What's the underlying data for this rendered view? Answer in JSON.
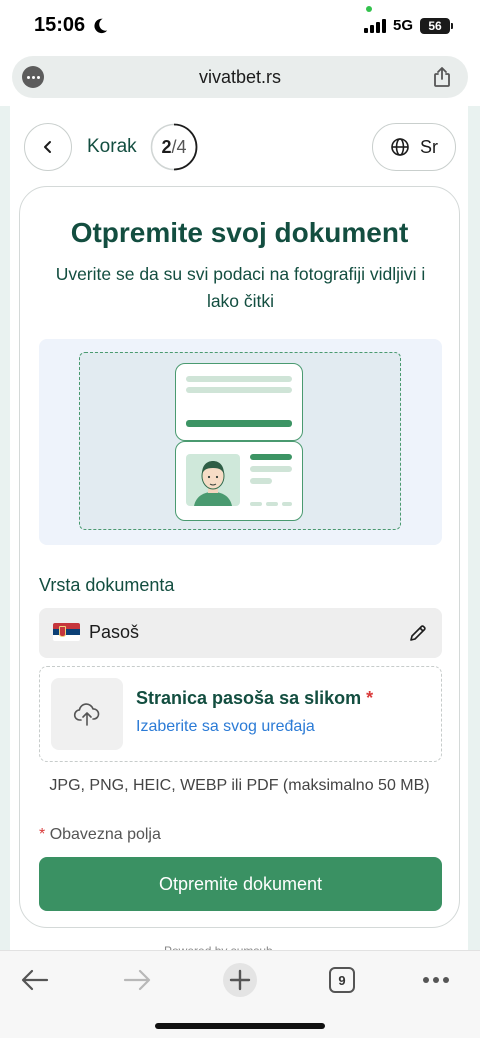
{
  "status_bar": {
    "time": "15:06",
    "network": "5G",
    "battery": "56"
  },
  "browser": {
    "url": "vivatbet.rs"
  },
  "nav": {
    "step_label": "Korak",
    "step_current": "2",
    "step_total": "/4",
    "step_progress": 0.5,
    "language": "Sr"
  },
  "card": {
    "title": "Otpremite svoj dokument",
    "subtitle": "Uverite se da su svi podaci na fotografiji vidljivi i lako čitki",
    "doc_type_label": "Vrsta dokumenta",
    "doc_type_value": "Pasoš",
    "upload_title": "Stranica pasoša sa slikom",
    "upload_required_mark": "*",
    "upload_link": "Izaberite sa svog uređaja",
    "formats": "JPG, PNG, HEIC, WEBP ili PDF (maksimalno 50 MB)",
    "required_note": "Obavezna polja",
    "required_mark": "*",
    "submit_label": "Otpremite dokument"
  },
  "footer": {
    "powered_by": "Powered by sumsub"
  },
  "toolbar": {
    "tab_count": "9"
  },
  "colors": {
    "brand_dark": "#134e40",
    "brand_button": "#3a9163",
    "link": "#2b7bd6",
    "required": "#d93a3a"
  },
  "icons": [
    "moon-icon",
    "signal-icon",
    "menu-dots-icon",
    "share-icon",
    "chevron-left-icon",
    "globe-icon",
    "serbian-flag-icon",
    "pencil-icon",
    "cloud-upload-icon",
    "back-arrow-icon",
    "forward-arrow-icon",
    "plus-icon",
    "tabs-icon",
    "more-icon"
  ]
}
